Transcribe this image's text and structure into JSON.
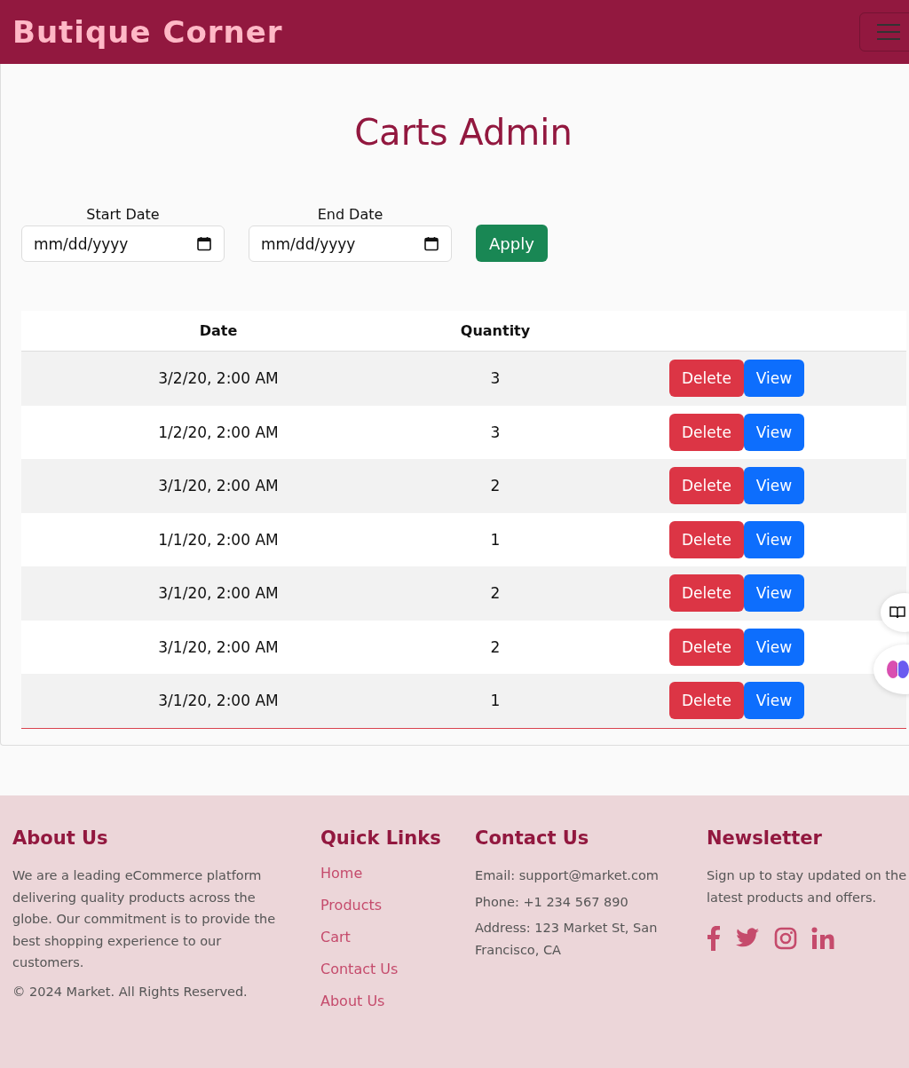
{
  "navbar": {
    "brand": "Butique Corner"
  },
  "page": {
    "title": "Carts Admin"
  },
  "filters": [
    {
      "label": "Start Date",
      "placeholder": "mm/dd/yyyy"
    },
    {
      "label": "End Date",
      "placeholder": "mm/dd/yyyy"
    }
  ],
  "apply_button": "Apply",
  "table": {
    "columns": [
      "Date",
      "Quantity"
    ],
    "rows": [
      {
        "date": "3/2/20, 2:00 AM",
        "quantity": "3",
        "delete": "Delete",
        "view": "View"
      },
      {
        "date": "1/2/20, 2:00 AM",
        "quantity": "3",
        "delete": "Delete",
        "view": "View"
      },
      {
        "date": "3/1/20, 2:00 AM",
        "quantity": "2",
        "delete": "Delete",
        "view": "View"
      },
      {
        "date": "1/1/20, 2:00 AM",
        "quantity": "1",
        "delete": "Delete",
        "view": "View"
      },
      {
        "date": "3/1/20, 2:00 AM",
        "quantity": "2",
        "delete": "Delete",
        "view": "View"
      },
      {
        "date": "3/1/20, 2:00 AM",
        "quantity": "2",
        "delete": "Delete",
        "view": "View"
      },
      {
        "date": "3/1/20, 2:00 AM",
        "quantity": "1",
        "delete": "Delete",
        "view": "View"
      }
    ]
  },
  "footer": {
    "about": {
      "heading": "About Us",
      "text": "We are a leading eCommerce platform delivering quality products across the globe. Our commitment is to provide the best shopping experience to our customers.",
      "copyright": "© 2024 Market. All Rights Reserved."
    },
    "quick_links": {
      "heading": "Quick Links",
      "links": [
        "Home",
        "Products",
        "Cart",
        "Contact Us",
        "About Us"
      ]
    },
    "contact": {
      "heading": "Contact Us",
      "lines": [
        "Email: support@market.com",
        "Phone: +1 234 567 890",
        "Address: 123 Market St, San Francisco, CA"
      ]
    },
    "newsletter": {
      "heading": "Newsletter",
      "text": "Sign up to stay updated on the latest products and offers.",
      "social": [
        {
          "kind": "facebook"
        },
        {
          "kind": "twitter"
        },
        {
          "kind": "instagram"
        },
        {
          "kind": "linkedin"
        }
      ]
    }
  }
}
